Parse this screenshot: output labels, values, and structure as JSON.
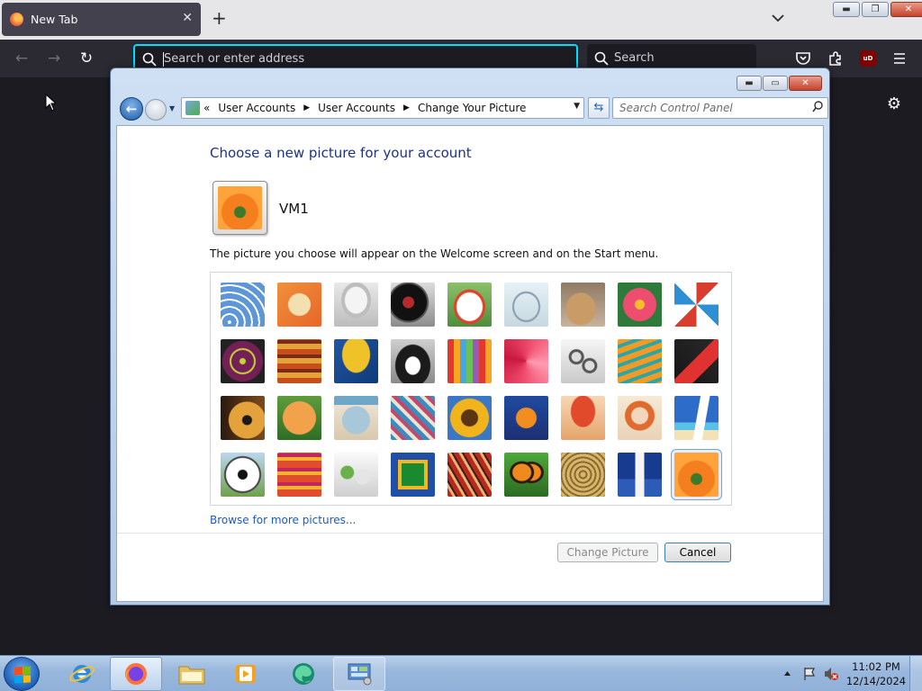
{
  "browser": {
    "tab_title": "New Tab",
    "tab_close": "✕",
    "new_tab": "+",
    "url_placeholder": "Search or enter address",
    "search_placeholder": "Search",
    "ublock_label": "uD"
  },
  "window": {
    "breadcrumbs": [
      "User Accounts",
      "User Accounts",
      "Change Your Picture"
    ],
    "breadcrumb_prefix": "«",
    "search_placeholder": "Search Control Panel"
  },
  "page": {
    "title": "Choose a new picture for your account",
    "username": "VM1",
    "description": "The picture you choose will appear on the Welcome screen and on the Start menu.",
    "browse_link": "Browse for more pictures...",
    "change_button": "Change Picture",
    "cancel_button": "Cancel",
    "selected_picture": "orange-flower"
  },
  "pictures": [
    "roller-coaster",
    "starfish",
    "robot-toy",
    "turntable",
    "lucky-cat",
    "gyroscope",
    "kitten",
    "pink-flower",
    "pinwheel",
    "bowling-ball",
    "fabric-stripes",
    "ginkgo-leaf",
    "border-collie",
    "crayons",
    "paper-star",
    "jacks",
    "stairs",
    "origami-crane",
    "guitar",
    "pomeranian",
    "tin-robot",
    "scarves",
    "sunflower",
    "goldfish",
    "hot-air-balloon",
    "kokeshi-doll",
    "sailboat",
    "soccer-ball",
    "striped-cloth",
    "marbles",
    "green-window",
    "woven-textile",
    "butterfly",
    "wicker-basket",
    "lighthouse",
    "orange-flower"
  ],
  "taskbar": {
    "apps": [
      "internet-explorer",
      "firefox",
      "file-explorer",
      "media-player",
      "edge-tool",
      "control-panel"
    ],
    "time": "11:02 PM",
    "date": "12/14/2024"
  },
  "colors": {
    "accent_focus": "#00ddff",
    "link": "#1a5ac8",
    "title": "#1e3287"
  }
}
